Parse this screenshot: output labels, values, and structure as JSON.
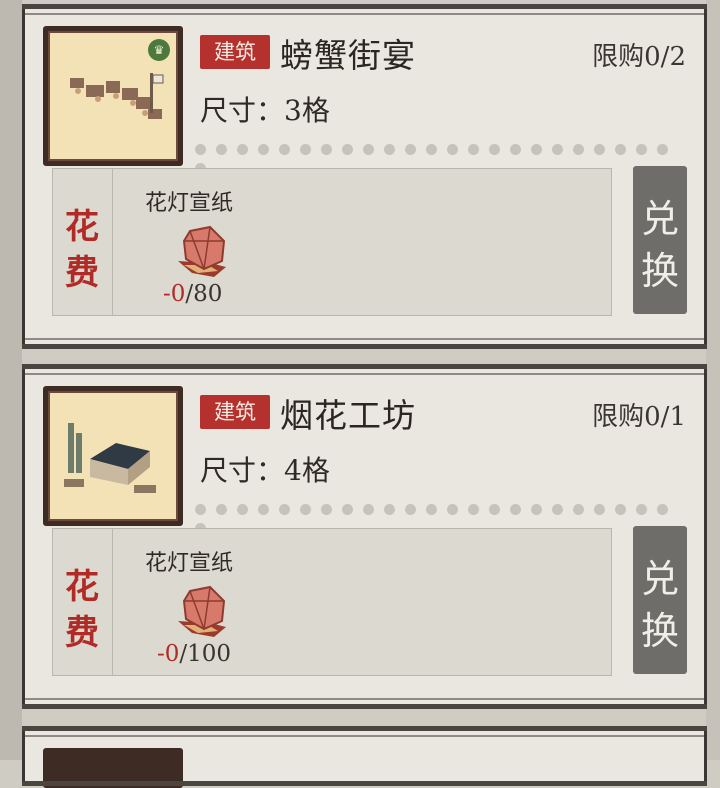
{
  "cards": [
    {
      "tag": "建筑",
      "title": "螃蟹街宴",
      "limit": "限购0/2",
      "size": "尺寸：3格",
      "cost_label_1": "花",
      "cost_label_2": "费",
      "item_name": "花灯宣纸",
      "count_neg": "-0",
      "count_total": "/80",
      "exchange_1": "兑",
      "exchange_2": "换",
      "icon": "crown-icon"
    },
    {
      "tag": "建筑",
      "title": "烟花工坊",
      "limit": "限购0/1",
      "size": "尺寸：4格",
      "cost_label_1": "花",
      "cost_label_2": "费",
      "item_name": "花灯宣纸",
      "count_neg": "-0",
      "count_total": "/100",
      "exchange_1": "兑",
      "exchange_2": "换"
    }
  ],
  "colors": {
    "tag_red": "#b5312d",
    "cost_red": "#b02a26",
    "exchange_gray": "#6e6d6a"
  }
}
